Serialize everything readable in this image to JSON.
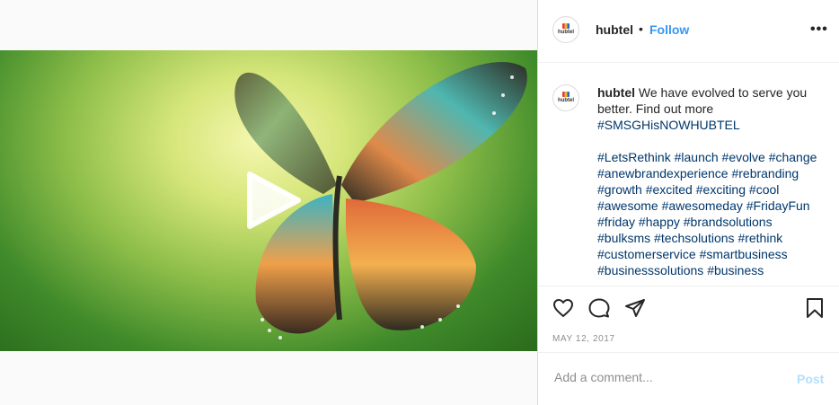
{
  "header": {
    "username": "hubtel",
    "separator": "•",
    "follow_label": "Follow",
    "more_icon": "more-options-icon",
    "more_glyph": "•••"
  },
  "avatar": {
    "brand_text": "hubtel"
  },
  "caption": {
    "username": "hubtel",
    "text": "We have evolved to serve you better. Find out more",
    "headline_tag": "#SMSGHisNOWHUBTEL",
    "hashtags": [
      "#LetsRethink",
      "#launch",
      "#evolve",
      "#change",
      "#anewbrandexperience",
      "#rebranding",
      "#growth",
      "#excited",
      "#exciting",
      "#cool",
      "#awesome",
      "#awesomeday",
      "#FridayFun",
      "#friday",
      "#happy",
      "#brandsolutions",
      "#bulksms",
      "#techsolutions",
      "#rethink",
      "#customerservice",
      "#smartbusiness",
      "#businesssolutions",
      "#business"
    ]
  },
  "actions": {
    "like_icon": "heart-icon",
    "comment_icon": "comment-icon",
    "share_icon": "share-icon",
    "save_icon": "bookmark-icon"
  },
  "post_date": "MAY 12, 2017",
  "comment": {
    "placeholder": "Add a comment...",
    "post_label": "Post"
  },
  "media": {
    "play_icon": "play-icon"
  },
  "colors": {
    "link": "#3897f0",
    "hashtag": "#00376b",
    "post_disabled": "#b2dffc"
  }
}
